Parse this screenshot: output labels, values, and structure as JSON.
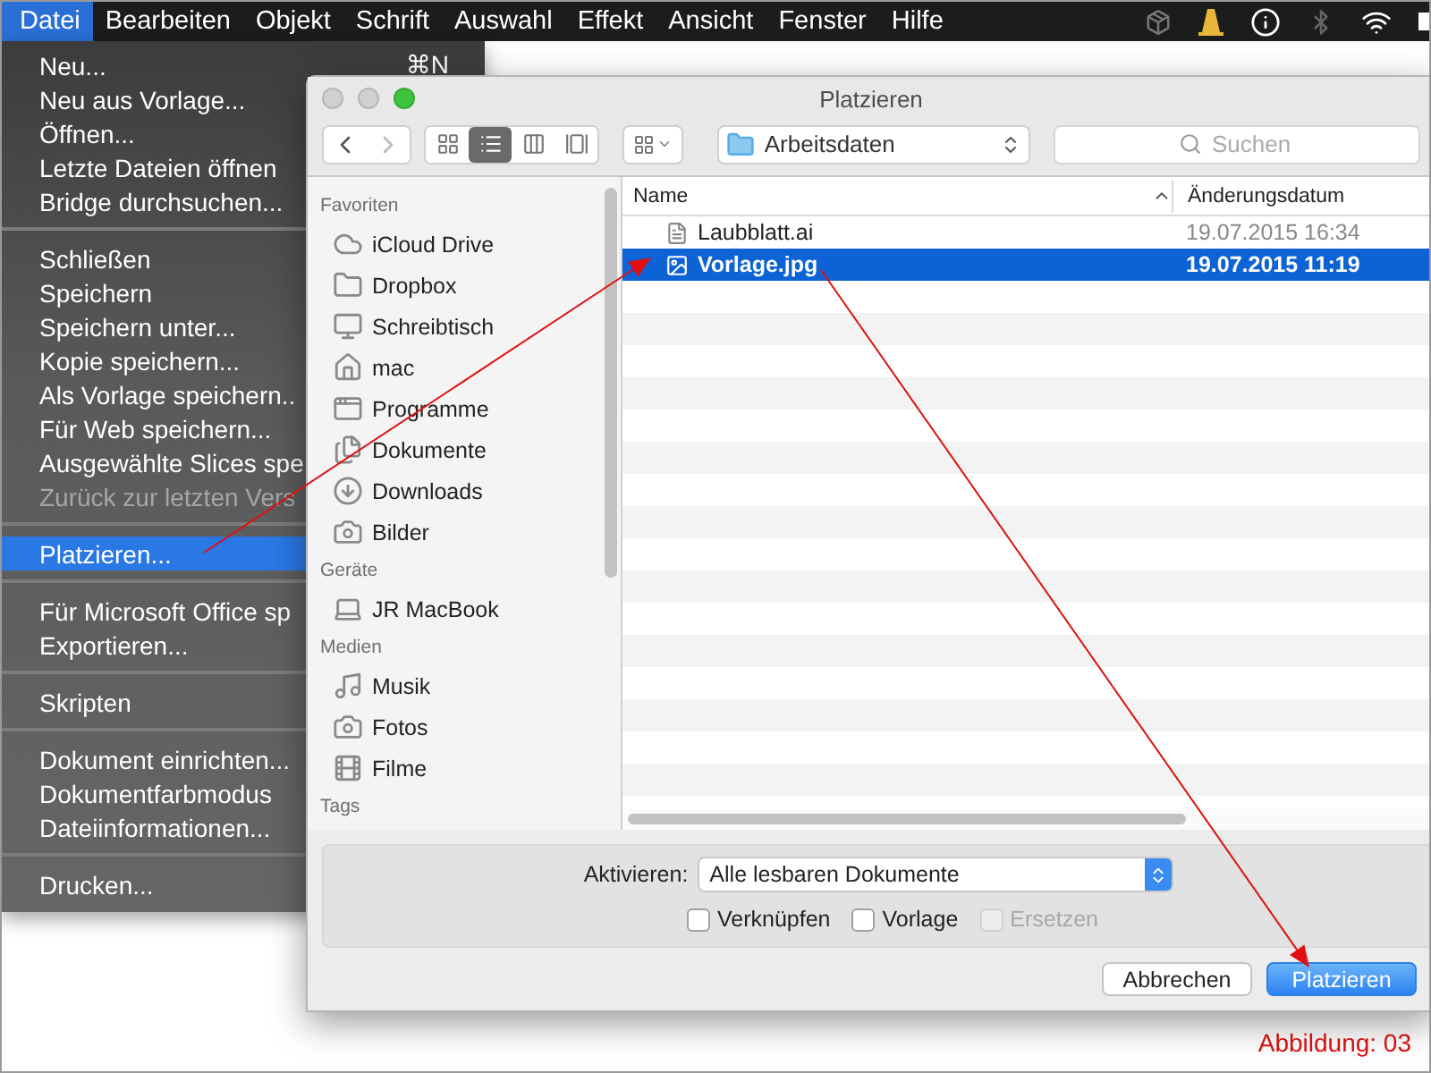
{
  "menu_bar": {
    "items": [
      {
        "label": "Datei",
        "selected": true
      },
      {
        "label": "Bearbeiten",
        "selected": false
      },
      {
        "label": "Objekt",
        "selected": false
      },
      {
        "label": "Schrift",
        "selected": false
      },
      {
        "label": "Auswahl",
        "selected": false
      },
      {
        "label": "Effekt",
        "selected": false
      },
      {
        "label": "Ansicht",
        "selected": false
      },
      {
        "label": "Fenster",
        "selected": false
      },
      {
        "label": "Hilfe",
        "selected": false
      }
    ]
  },
  "file_menu": {
    "groups": [
      [
        {
          "label": "Neu...",
          "shortcut": "⌘N",
          "selected": false,
          "disabled": false
        },
        {
          "label": "Neu aus Vorlage...",
          "selected": false,
          "disabled": false
        },
        {
          "label": "Öffnen...",
          "selected": false,
          "disabled": false
        },
        {
          "label": "Letzte Dateien öffnen",
          "selected": false,
          "disabled": false
        },
        {
          "label": "Bridge durchsuchen...",
          "selected": false,
          "disabled": false
        }
      ],
      [
        {
          "label": "Schließen",
          "selected": false,
          "disabled": false
        },
        {
          "label": "Speichern",
          "selected": false,
          "disabled": false
        },
        {
          "label": "Speichern unter...",
          "selected": false,
          "disabled": false
        },
        {
          "label": "Kopie speichern...",
          "selected": false,
          "disabled": false
        },
        {
          "label": "Als Vorlage speichern..",
          "selected": false,
          "disabled": false
        },
        {
          "label": "Für Web speichern...",
          "selected": false,
          "disabled": false
        },
        {
          "label": "Ausgewählte Slices spe",
          "selected": false,
          "disabled": false
        },
        {
          "label": "Zurück zur letzten Vers",
          "selected": false,
          "disabled": true
        }
      ],
      [
        {
          "label": "Platzieren...",
          "selected": true,
          "disabled": false
        }
      ],
      [
        {
          "label": "Für Microsoft Office sp",
          "selected": false,
          "disabled": false
        },
        {
          "label": "Exportieren...",
          "selected": false,
          "disabled": false
        }
      ],
      [
        {
          "label": "Skripten",
          "selected": false,
          "disabled": false
        }
      ],
      [
        {
          "label": "Dokument einrichten...",
          "selected": false,
          "disabled": false
        },
        {
          "label": "Dokumentfarbmodus",
          "selected": false,
          "disabled": false
        },
        {
          "label": "Dateiinformationen...",
          "selected": false,
          "disabled": false
        }
      ],
      [
        {
          "label": "Drucken...",
          "selected": false,
          "disabled": false
        }
      ]
    ]
  },
  "dialog": {
    "title": "Platzieren",
    "view_modes": [
      {
        "selected": false
      },
      {
        "selected": true
      },
      {
        "selected": false
      },
      {
        "selected": false
      }
    ],
    "path": "Arbeitsdaten",
    "search": {
      "placeholder": "Suchen"
    },
    "sidebar": [
      {
        "heading": "Favoriten",
        "items": [
          "iCloud Drive",
          "Dropbox",
          "Schreibtisch",
          "mac",
          "Programme",
          "Dokumente",
          "Downloads",
          "Bilder"
        ]
      },
      {
        "heading": "Geräte",
        "items": [
          "JR MacBook"
        ]
      },
      {
        "heading": "Medien",
        "items": [
          "Musik",
          "Fotos",
          "Filme"
        ]
      },
      {
        "heading": "Tags"
      }
    ],
    "file_list": {
      "columns": [
        "Name",
        "Änderungsdatum"
      ],
      "rows": [
        {
          "name": "Laubblatt.ai",
          "date": "19.07.2015 16:34",
          "selected": false
        },
        {
          "name": "Vorlage.jpg",
          "date": "19.07.2015 11:19",
          "selected": true
        }
      ]
    },
    "options": {
      "label": "Aktivieren:",
      "format": "Alle lesbaren Dokumente",
      "checkboxes": [
        {
          "label": "Verknüpfen",
          "checked": false,
          "disabled": false
        },
        {
          "label": "Vorlage",
          "checked": false,
          "disabled": false
        },
        {
          "label": "Ersetzen",
          "checked": false,
          "disabled": true
        }
      ]
    },
    "buttons": [
      {
        "label": "Abbrechen",
        "default": false
      },
      {
        "label": "Platzieren",
        "default": true
      }
    ]
  },
  "caption": "Abbildung: 03"
}
